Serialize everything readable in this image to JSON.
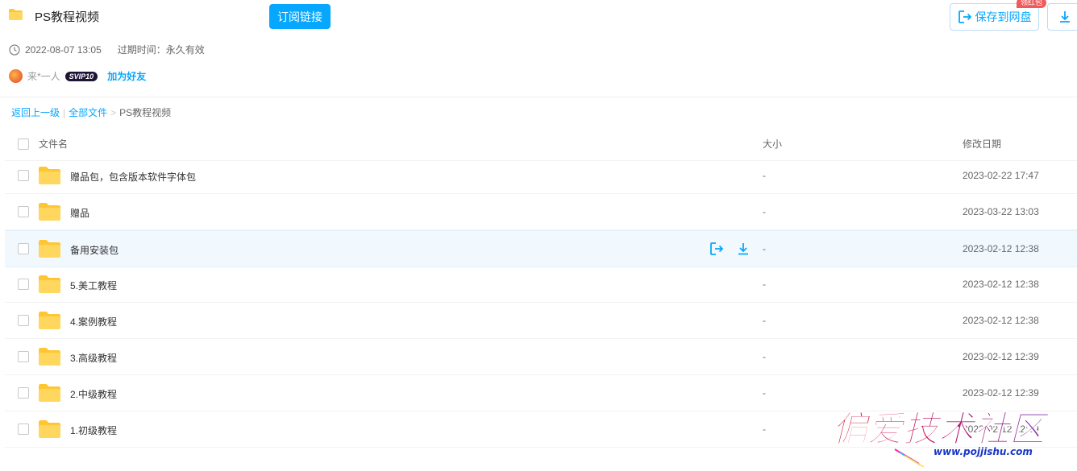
{
  "header": {
    "title": "PS教程视频",
    "subscribe_label": "订阅链接",
    "save_label": "保存到网盘",
    "badge": "领红包"
  },
  "meta": {
    "created": "2022-08-07 13:05",
    "expire_label": "过期时间：永久有效"
  },
  "user": {
    "name": "来*一人",
    "vip": "SVIP10",
    "add_friend": "加为好友"
  },
  "breadcrumb": {
    "back": "返回上一级",
    "sep1": "|",
    "all": "全部文件",
    "sep2": ">",
    "current": "PS教程视频"
  },
  "table": {
    "col_name": "文件名",
    "col_size": "大小",
    "col_date": "修改日期",
    "rows": [
      {
        "name": "赠品包，包含版本软件字体包",
        "size": "-",
        "date": "2023-02-22 17:47"
      },
      {
        "name": "赠品",
        "size": "-",
        "date": "2023-03-22 13:03"
      },
      {
        "name": "备用安装包",
        "size": "-",
        "date": "2023-02-12 12:38"
      },
      {
        "name": "5.美工教程",
        "size": "-",
        "date": "2023-02-12 12:38"
      },
      {
        "name": "4.案例教程",
        "size": "-",
        "date": "2023-02-12 12:38"
      },
      {
        "name": "3.高级教程",
        "size": "-",
        "date": "2023-02-12 12:39"
      },
      {
        "name": "2.中级教程",
        "size": "-",
        "date": "2023-02-12 12:39"
      },
      {
        "name": "1.初级教程",
        "size": "-",
        "date": "2023-02-12 12:39"
      }
    ]
  },
  "watermark": {
    "text": "偏爱技术社区",
    "url": "www.pojjishu.com"
  },
  "colors": {
    "accent": "#06a7ff",
    "folder": "#ffd04b",
    "row_highlight": "#f1f8fe"
  }
}
